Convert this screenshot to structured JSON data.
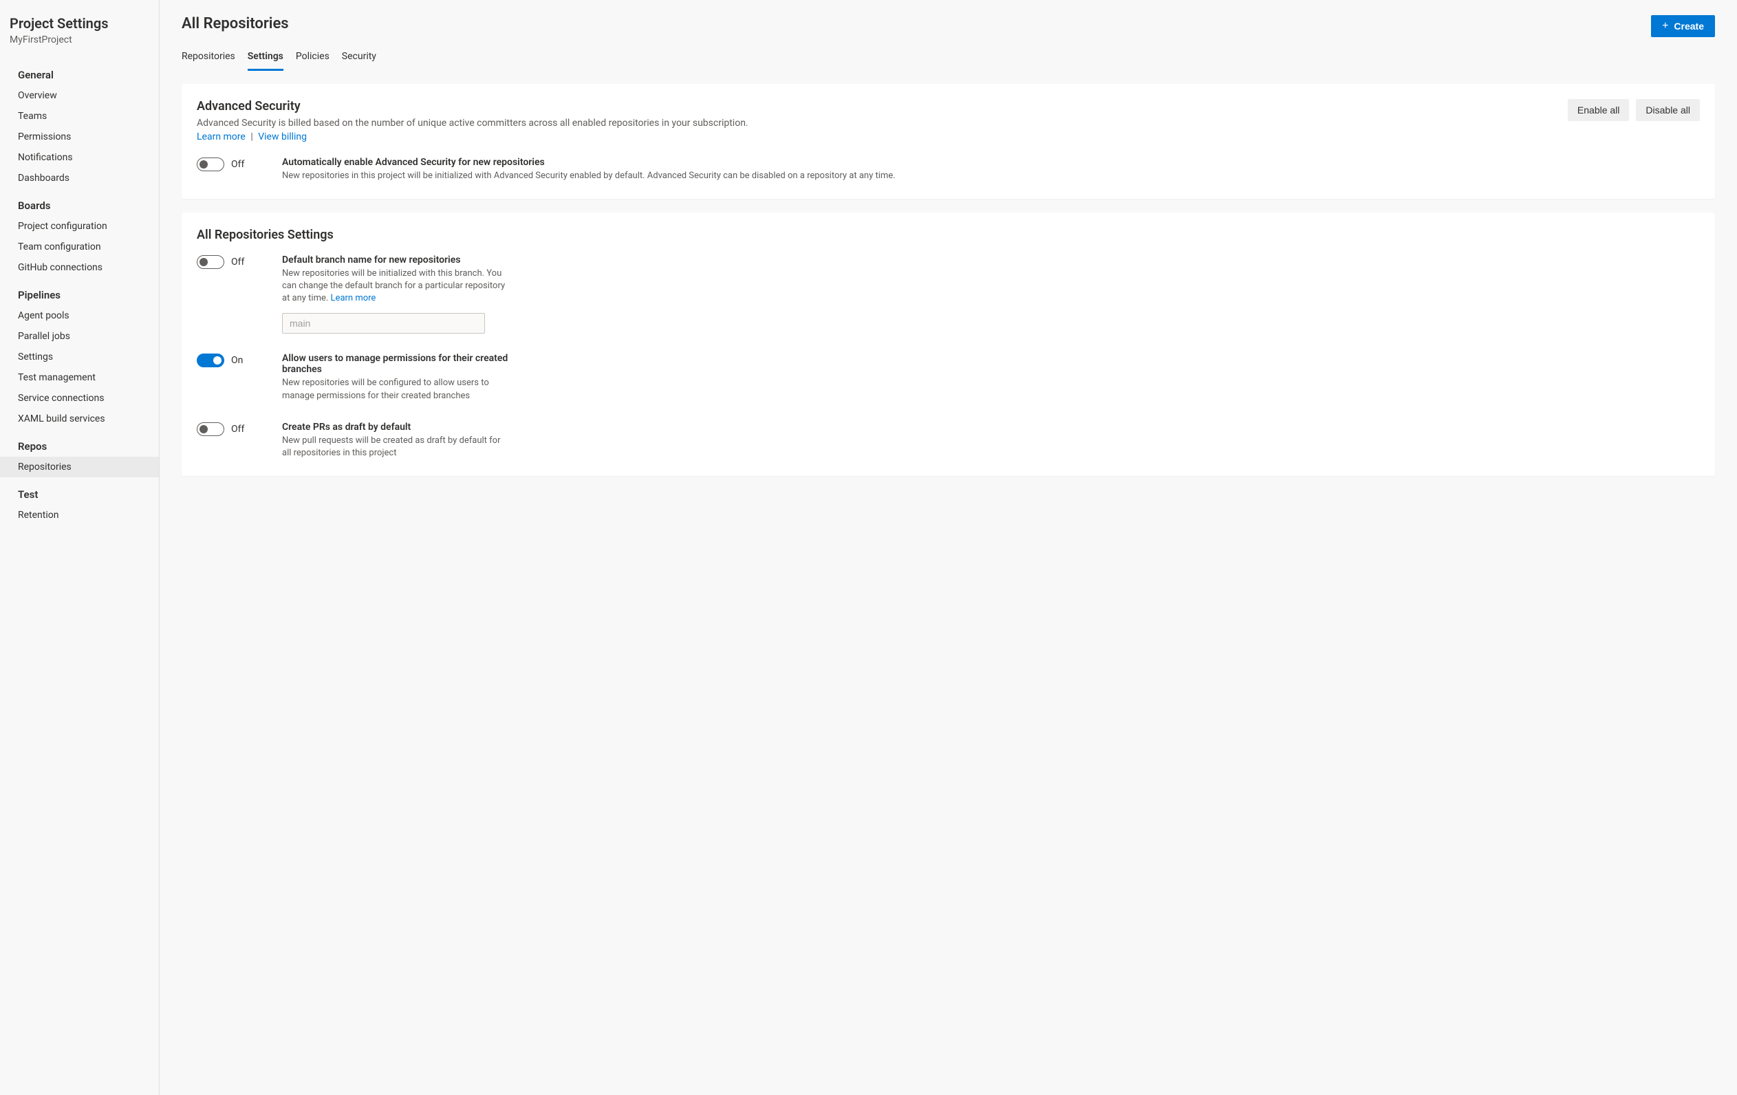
{
  "sidebar": {
    "title": "Project Settings",
    "subtitle": "MyFirstProject",
    "groups": [
      {
        "title": "General",
        "items": [
          {
            "label": "Overview"
          },
          {
            "label": "Teams"
          },
          {
            "label": "Permissions"
          },
          {
            "label": "Notifications"
          },
          {
            "label": "Dashboards"
          }
        ]
      },
      {
        "title": "Boards",
        "items": [
          {
            "label": "Project configuration"
          },
          {
            "label": "Team configuration"
          },
          {
            "label": "GitHub connections"
          }
        ]
      },
      {
        "title": "Pipelines",
        "items": [
          {
            "label": "Agent pools"
          },
          {
            "label": "Parallel jobs"
          },
          {
            "label": "Settings"
          },
          {
            "label": "Test management"
          },
          {
            "label": "Service connections"
          },
          {
            "label": "XAML build services"
          }
        ]
      },
      {
        "title": "Repos",
        "items": [
          {
            "label": "Repositories",
            "selected": true
          }
        ]
      },
      {
        "title": "Test",
        "items": [
          {
            "label": "Retention"
          }
        ]
      }
    ]
  },
  "page": {
    "title": "All Repositories",
    "create_label": "Create"
  },
  "tabs": [
    {
      "label": "Repositories"
    },
    {
      "label": "Settings",
      "active": true
    },
    {
      "label": "Policies"
    },
    {
      "label": "Security"
    }
  ],
  "advanced_security": {
    "title": "Advanced Security",
    "description": "Advanced Security is billed based on the number of unique active committers across all enabled repositories in your subscription.",
    "learn_more": "Learn more",
    "separator": "|",
    "view_billing": "View billing",
    "enable_all": "Enable all",
    "disable_all": "Disable all",
    "auto_toggle": {
      "state": "off",
      "state_label": "Off",
      "title": "Automatically enable Advanced Security for new repositories",
      "description": "New repositories in this project will be initialized with Advanced Security enabled by default. Advanced Security can be disabled on a repository at any time."
    }
  },
  "repos_settings": {
    "title": "All Repositories Settings",
    "default_branch": {
      "state": "off",
      "state_label": "Off",
      "title": "Default branch name for new repositories",
      "description": "New repositories will be initialized with this branch. You can change the default branch for a particular repository at any time. ",
      "learn_more": "Learn more",
      "placeholder": "main",
      "value": ""
    },
    "manage_permissions": {
      "state": "on",
      "state_label": "On",
      "title": "Allow users to manage permissions for their created branches",
      "description": "New repositories will be configured to allow users to manage permissions for their created branches"
    },
    "draft_prs": {
      "state": "off",
      "state_label": "Off",
      "title": "Create PRs as draft by default",
      "description": "New pull requests will be created as draft by default for all repositories in this project"
    }
  }
}
